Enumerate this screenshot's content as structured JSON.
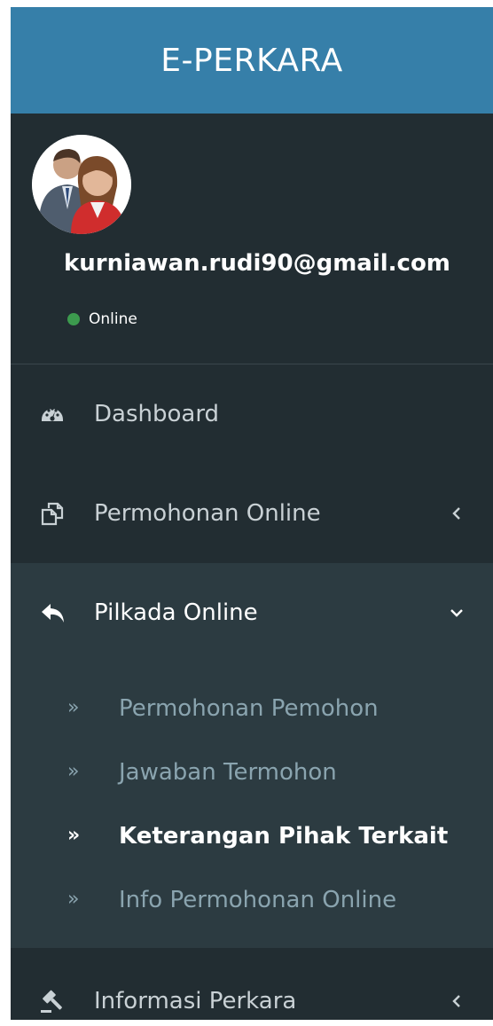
{
  "logo": {
    "text": "E-PERKARA"
  },
  "user": {
    "email": "kurniawan.rudi90@gmail.com",
    "status": "Online",
    "status_color": "#3c9a4e"
  },
  "colors": {
    "header": "#367fa9",
    "sidebar": "#222d32",
    "active": "#2c3b41"
  },
  "menu": [
    {
      "label": "Dashboard",
      "icon": "dashboard-icon"
    },
    {
      "label": "Permohonan Online",
      "icon": "copy-icon",
      "chevron": "chevron-left"
    },
    {
      "label": "Pilkada Online",
      "icon": "reply-icon",
      "chevron": "chevron-down",
      "expanded": true
    },
    {
      "label": "Informasi Perkara",
      "icon": "gavel-icon",
      "chevron": "chevron-left"
    }
  ],
  "submenu": [
    {
      "label": "Permohonan Pemohon"
    },
    {
      "label": "Jawaban Termohon"
    },
    {
      "label": "Keterangan Pihak Terkait",
      "current": true
    },
    {
      "label": "Info Permohonan Online"
    }
  ],
  "submenu_bullet": "»"
}
